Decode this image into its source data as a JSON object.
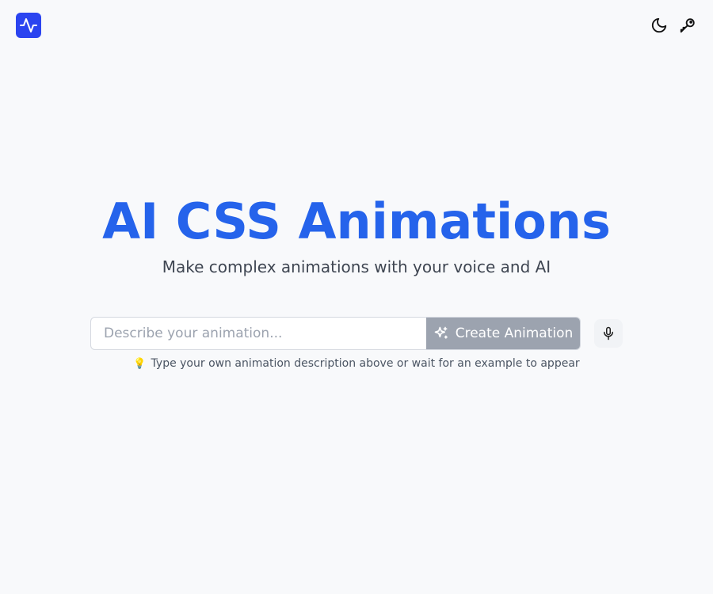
{
  "header": {
    "logo_icon": "activity-pulse-icon",
    "actions": [
      {
        "icon": "moon-icon",
        "label": "theme-toggle"
      },
      {
        "icon": "key-icon",
        "label": "api-key"
      }
    ]
  },
  "hero": {
    "title": "AI CSS Animations",
    "subtitle": "Make complex animations with your voice and AI"
  },
  "prompt": {
    "placeholder": "Describe your animation...",
    "value": "",
    "create_label": "Create Animation",
    "create_icon": "sparkles-icon",
    "mic_icon": "microphone-icon"
  },
  "hint": {
    "icon": "lightbulb-icon",
    "text": "Type your own animation description above or wait for an example to appear"
  },
  "colors": {
    "accent": "#2563eb",
    "logo_bg": "#2b44f0",
    "button_disabled": "#9ca3af",
    "background": "#f8f9fb"
  }
}
